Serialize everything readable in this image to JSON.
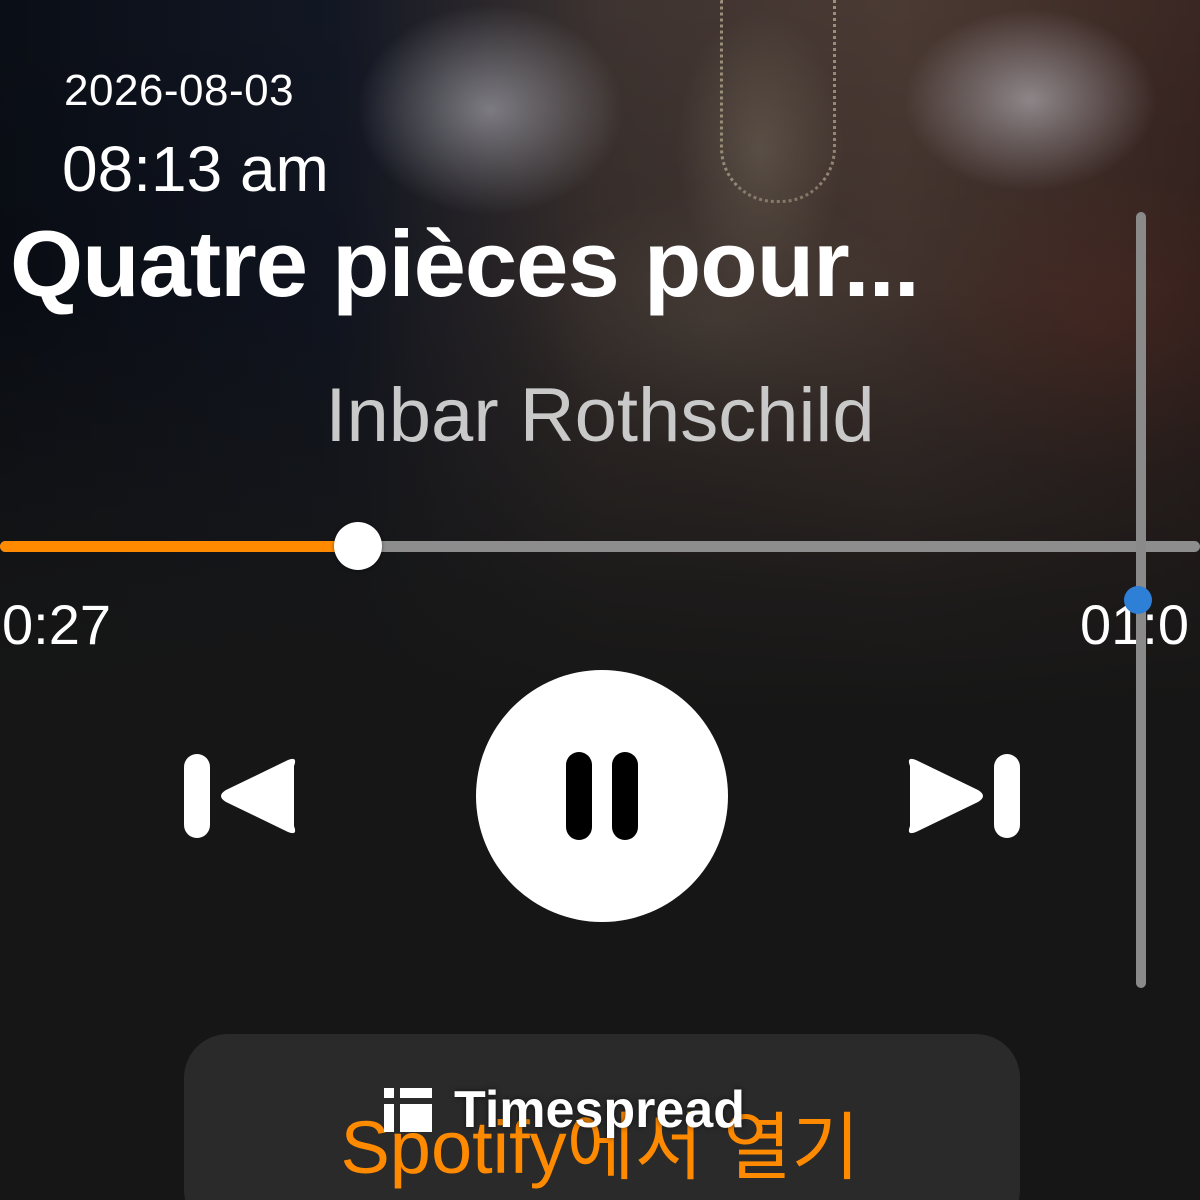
{
  "status": {
    "date": "2026-08-03",
    "time": "08:13 am"
  },
  "track": {
    "title": "Quatre pièces pour...",
    "artist": "Inbar Rothschild"
  },
  "progress": {
    "elapsed": "0:27",
    "remaining": "01:0",
    "fraction": 0.298,
    "played_color": "#ff8a00",
    "remaining_color": "#8d8d8d"
  },
  "controls": {
    "previous_icon": "skip-previous-icon",
    "pause_icon": "pause-icon",
    "next_icon": "skip-next-icon"
  },
  "open_button": {
    "label": "Spotify에서 열기",
    "color": "#ff8a00"
  },
  "watermark": {
    "text": "Timespread"
  }
}
